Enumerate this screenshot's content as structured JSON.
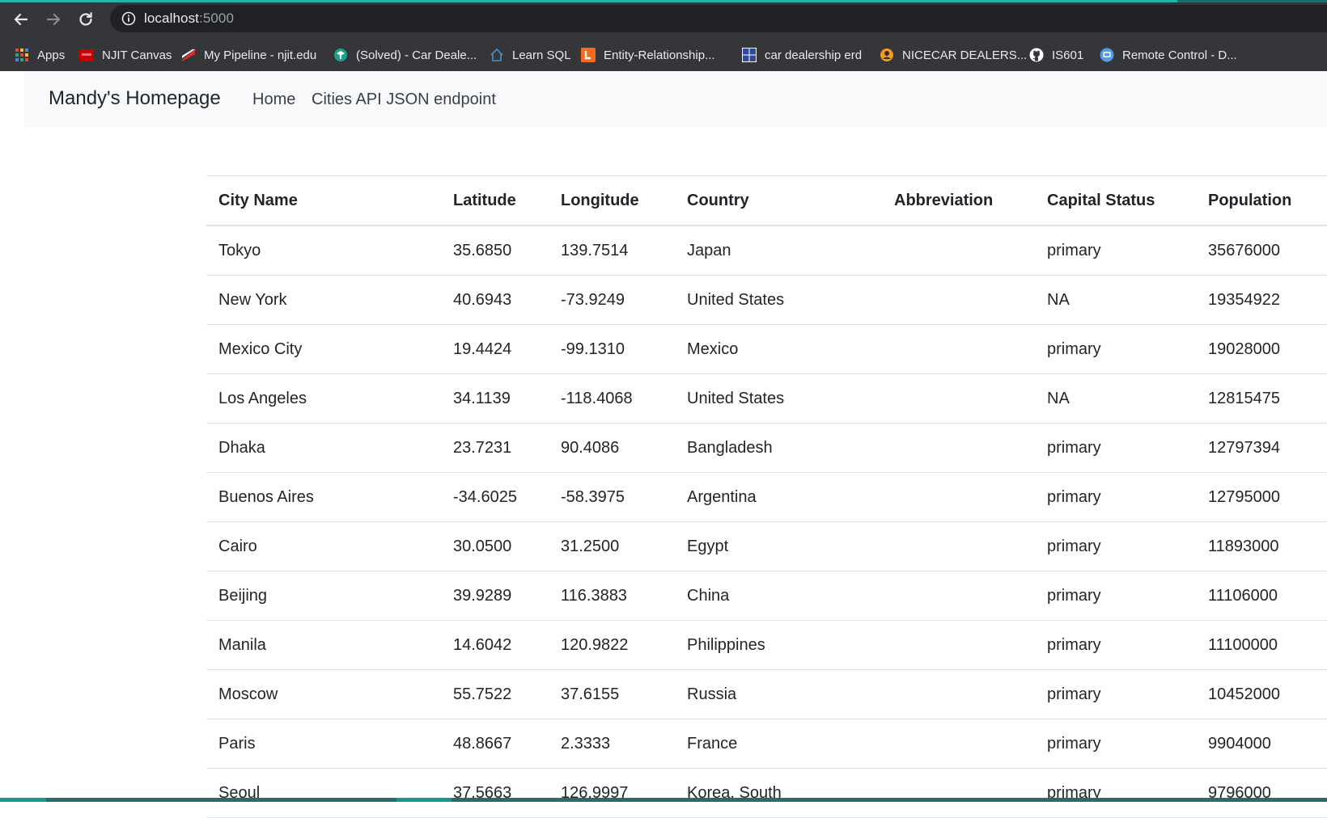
{
  "browser": {
    "url_host": "localhost",
    "url_port": ":5000",
    "bookmarks": [
      {
        "label": "Apps",
        "icon": "apps-grid-icon",
        "color": "#e8453c"
      },
      {
        "label": "NJIT Canvas",
        "icon": "njit-logo-icon",
        "color": "#cc0000"
      },
      {
        "label": "My Pipeline - njit.edu",
        "icon": "pipeline-icon",
        "color": "#d92b2b"
      },
      {
        "label": "(Solved) - Car Deale...",
        "icon": "coursehero-icon",
        "color": "#1aa18c"
      },
      {
        "label": "Learn SQL",
        "icon": "house-icon",
        "color": "#4a90c8"
      },
      {
        "label": "Entity-Relationship...",
        "icon": "lucidchart-icon",
        "color": "#f26b21"
      },
      {
        "label": "car dealership erd",
        "icon": "csee-icon",
        "color": "#2f4b9a"
      },
      {
        "label": "NICECAR DEALERS...",
        "icon": "nicecar-icon",
        "color": "#f29b1d"
      },
      {
        "label": "IS601",
        "icon": "github-icon",
        "color": "#ffffff"
      },
      {
        "label": "Remote Control - D...",
        "icon": "remote-control-icon",
        "color": "#4f9de8"
      }
    ]
  },
  "navbar": {
    "brand": "Mandy's Homepage",
    "links": [
      "Home",
      "Cities API JSON endpoint"
    ]
  },
  "table": {
    "columns": [
      "City Name",
      "Latitude",
      "Longitude",
      "Country",
      "Abbreviation",
      "Capital Status",
      "Population"
    ],
    "rows": [
      [
        "Tokyo",
        "35.6850",
        "139.7514",
        "Japan",
        "",
        "primary",
        "35676000"
      ],
      [
        "New York",
        "40.6943",
        "-73.9249",
        "United States",
        "",
        "NA",
        "19354922"
      ],
      [
        "Mexico City",
        "19.4424",
        "-99.1310",
        "Mexico",
        "",
        "primary",
        "19028000"
      ],
      [
        "Los Angeles",
        "34.1139",
        "-118.4068",
        "United States",
        "",
        "NA",
        "12815475"
      ],
      [
        "Dhaka",
        "23.7231",
        "90.4086",
        "Bangladesh",
        "",
        "primary",
        "12797394"
      ],
      [
        "Buenos Aires",
        "-34.6025",
        "-58.3975",
        "Argentina",
        "",
        "primary",
        "12795000"
      ],
      [
        "Cairo",
        "30.0500",
        "31.2500",
        "Egypt",
        "",
        "primary",
        "11893000"
      ],
      [
        "Beijing",
        "39.9289",
        "116.3883",
        "China",
        "",
        "primary",
        "11106000"
      ],
      [
        "Manila",
        "14.6042",
        "120.9822",
        "Philippines",
        "",
        "primary",
        "11100000"
      ],
      [
        "Moscow",
        "55.7522",
        "37.6155",
        "Russia",
        "",
        "primary",
        "10452000"
      ],
      [
        "Paris",
        "48.8667",
        "2.3333",
        "France",
        "",
        "primary",
        "9904000"
      ],
      [
        "Seoul",
        "37.5663",
        "126.9997",
        "Korea, South",
        "",
        "primary",
        "9796000"
      ]
    ]
  }
}
